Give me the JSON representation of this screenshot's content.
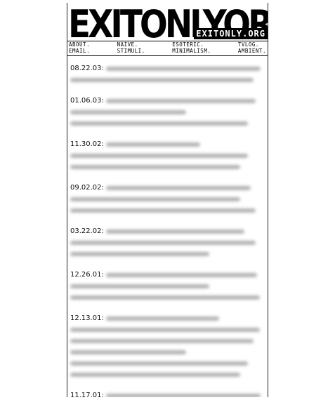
{
  "site": {
    "logo_big": "EXITONLYORG",
    "logo_small": "EXITONLY.ORG"
  },
  "nav": [
    {
      "top": "ABOUT.",
      "bottom": "EMAIL."
    },
    {
      "top": "NAIVE.",
      "bottom": "STIMULI."
    },
    {
      "top": "ESOTERIC.",
      "bottom": "MINIMALISM."
    },
    {
      "top": "TVLOG.",
      "bottom": "AMBIENT."
    }
  ],
  "entries": [
    {
      "date": "08.22.03:",
      "lines": 2
    },
    {
      "date": "01.06.03:",
      "lines": 3
    },
    {
      "date": "11.30.02:",
      "lines": 3
    },
    {
      "date": "09.02.02:",
      "lines": 3
    },
    {
      "date": "03.22.02:",
      "lines": 3
    },
    {
      "date": "12.26.01:",
      "lines": 3
    },
    {
      "date": "12.13.01:",
      "lines": 6
    },
    {
      "date": "11.17.01:",
      "lines": 2
    }
  ]
}
